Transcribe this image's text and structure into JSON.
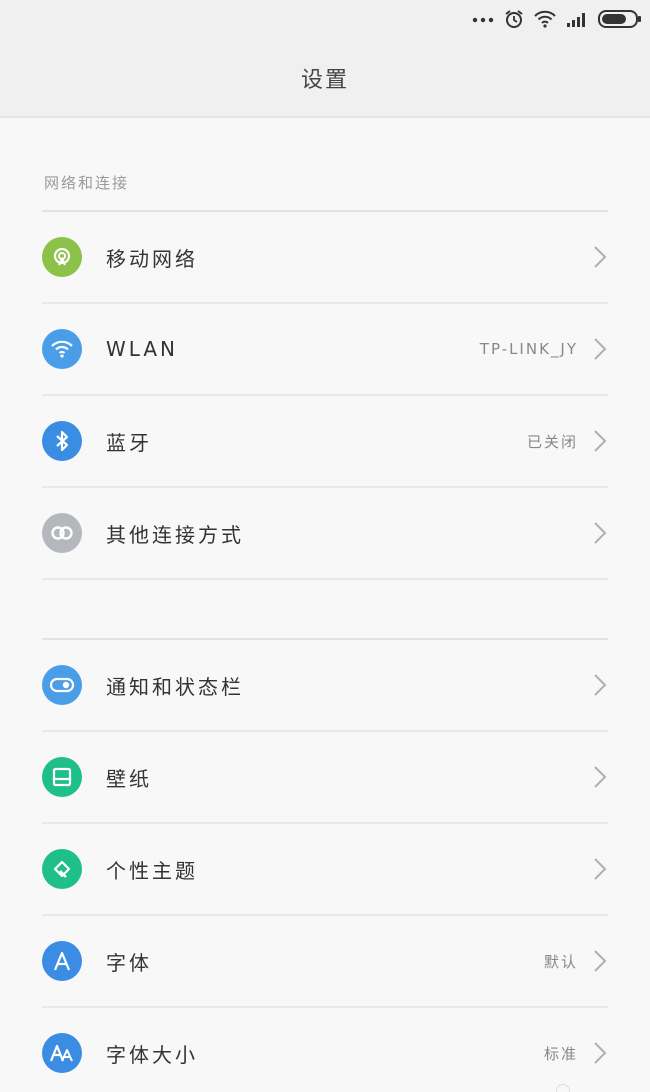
{
  "status_bar": {
    "icons": [
      "more-dots-icon",
      "alarm-icon",
      "wifi-icon",
      "signal-icon",
      "battery-icon"
    ]
  },
  "header": {
    "title": "设置"
  },
  "sections": {
    "network": {
      "header": "网络和连接",
      "items": [
        {
          "label": "移动网络",
          "value": "",
          "icon": "mobile-network-icon",
          "color": "#8cc24a"
        },
        {
          "label": "WLAN",
          "value": "TP-LINK_JY",
          "icon": "wifi-icon",
          "color": "#4a9ee8"
        },
        {
          "label": "蓝牙",
          "value": "已关闭",
          "icon": "bluetooth-icon",
          "color": "#3b8de3"
        },
        {
          "label": "其他连接方式",
          "value": "",
          "icon": "link-icon",
          "color": "#b4b8bd"
        }
      ]
    },
    "display": {
      "items": [
        {
          "label": "通知和状态栏",
          "value": "",
          "icon": "notification-toggle-icon",
          "color": "#4a9ee8"
        },
        {
          "label": "壁纸",
          "value": "",
          "icon": "wallpaper-icon",
          "color": "#1fbf8a"
        },
        {
          "label": "个性主题",
          "value": "",
          "icon": "theme-brush-icon",
          "color": "#1fbf8a"
        },
        {
          "label": "字体",
          "value": "默认",
          "icon": "font-icon",
          "color": "#3b8de3"
        },
        {
          "label": "字体大小",
          "value": "标准",
          "icon": "font-size-icon",
          "color": "#3b8de3"
        }
      ]
    }
  }
}
